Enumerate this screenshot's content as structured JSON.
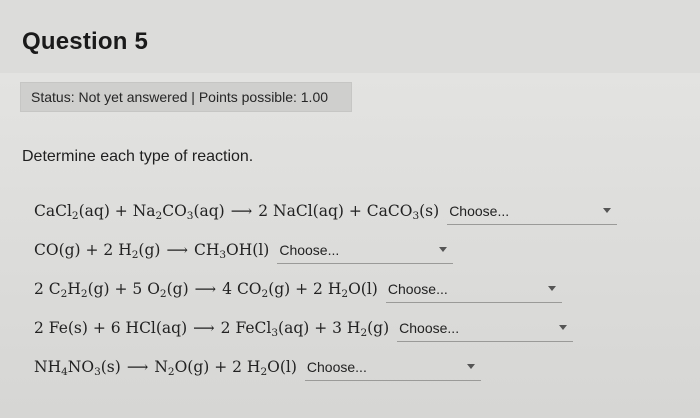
{
  "question": {
    "title": "Question 5"
  },
  "status": {
    "text": "Status: Not yet answered | Points possible: 1.00"
  },
  "prompt": "Determine each type of reaction.",
  "reactions": [
    {
      "choose_label": "Choose..."
    },
    {
      "choose_label": "Choose..."
    },
    {
      "choose_label": "Choose..."
    },
    {
      "choose_label": "Choose..."
    },
    {
      "choose_label": "Choose..."
    }
  ],
  "icons": {
    "dropdown": "caret-down-icon"
  }
}
